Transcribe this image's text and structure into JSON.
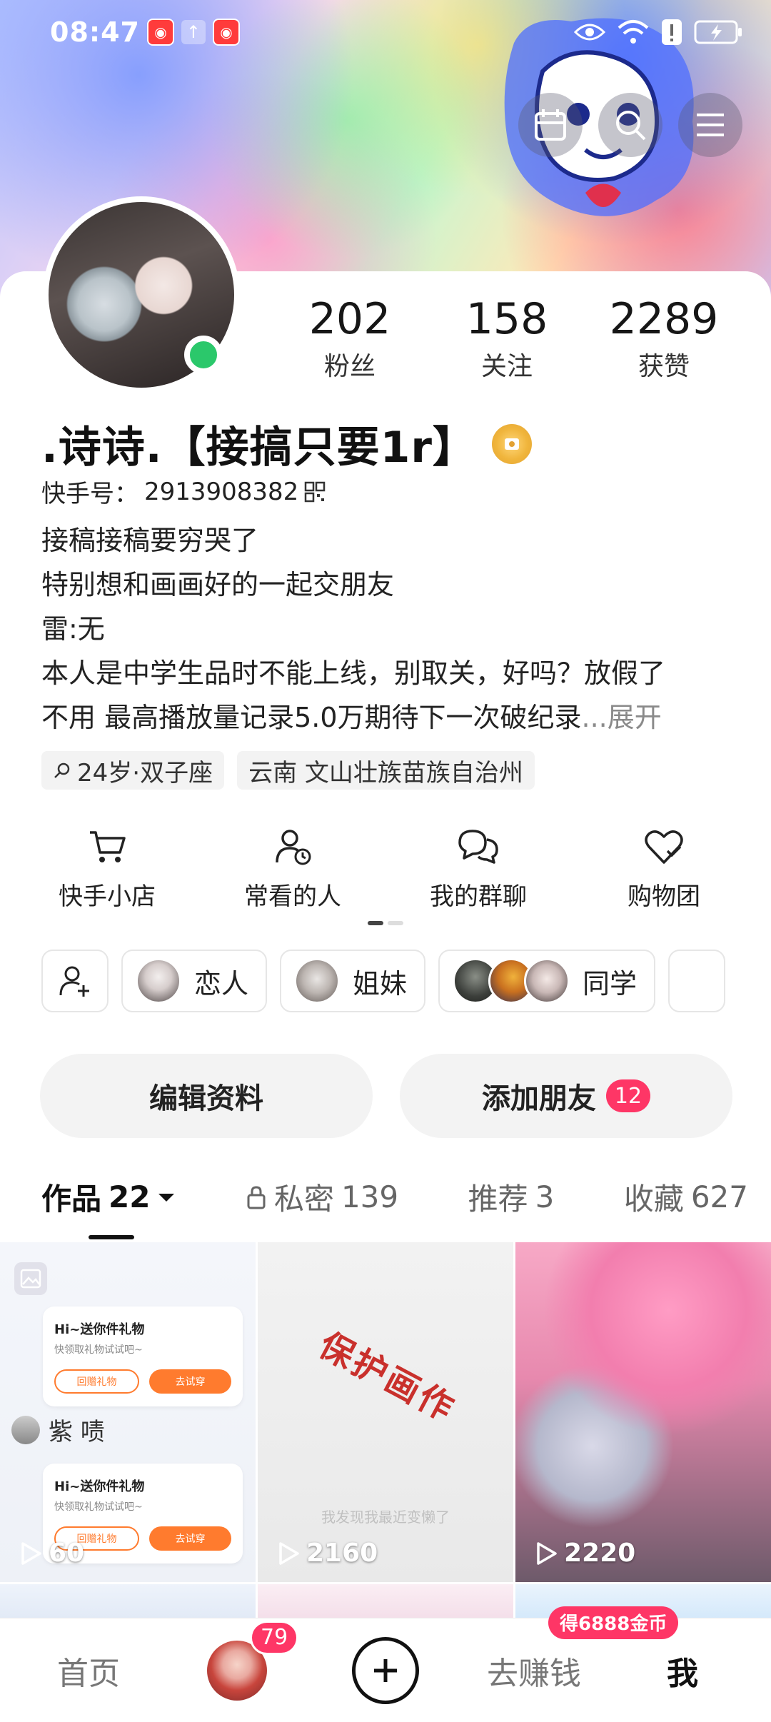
{
  "status_bar": {
    "time": "08:47",
    "icons": [
      "app-notification-icon",
      "upload-icon",
      "app-notification-icon",
      "eye-icon",
      "wifi-icon",
      "alert-icon",
      "battery-charging-icon"
    ]
  },
  "header_actions": [
    "calendar-icon",
    "search-icon",
    "menu-icon"
  ],
  "profile": {
    "name": ".诗诗.【接搞只要1r】",
    "kuaishou_id_label": "快手号：",
    "kuaishou_id": "2913908382",
    "online": true,
    "stats": [
      {
        "value": "202",
        "label": "粉丝"
      },
      {
        "value": "158",
        "label": "关注"
      },
      {
        "value": "2289",
        "label": "获赞"
      }
    ],
    "bio_lines": [
      "接稿接稿要穷哭了",
      "特别想和画画好的一起交朋友",
      "雷:无",
      "本人是中学生品时不能上线，别取关，好吗？放假了",
      "不用 最高播放量记录5.0万期待下一次破纪录"
    ],
    "bio_more": "...展开",
    "tags": [
      "24岁·双子座",
      "云南 文山壮族苗族自治州"
    ]
  },
  "quick_actions": [
    {
      "label": "快手小店",
      "icon": "cart-icon"
    },
    {
      "label": "常看的人",
      "icon": "person-clock-icon"
    },
    {
      "label": "我的群聊",
      "icon": "group-chat-icon"
    },
    {
      "label": "购物团",
      "icon": "heart-check-icon"
    }
  ],
  "relations": [
    {
      "label": "恋人",
      "avatars": 1
    },
    {
      "label": "姐妹",
      "avatars": 1
    },
    {
      "label": "同学",
      "avatars": 3
    }
  ],
  "buttons": {
    "edit_profile": "编辑资料",
    "add_friend": "添加朋友",
    "add_friend_count": "12"
  },
  "tabs": [
    {
      "label": "作品",
      "count": "22",
      "active": true
    },
    {
      "label": "私密",
      "count": "139",
      "active": false
    },
    {
      "label": "推荐",
      "count": "3",
      "active": false
    },
    {
      "label": "收藏",
      "count": "627",
      "active": false
    }
  ],
  "grid": [
    {
      "plays": "60",
      "mini_title": "Hi~送你件礼物",
      "mini_sub": "快领取礼物试试吧~",
      "mini_btn1": "回赠礼物",
      "mini_btn2": "去试穿",
      "name_tag": "紫 啧"
    },
    {
      "plays": "2160",
      "stamp": "保护画作",
      "caption": "我发现我最近变懒了"
    },
    {
      "plays": "2220"
    }
  ],
  "bottom_nav": {
    "home": "首页",
    "avatar_badge": "79",
    "earn": "去赚钱",
    "earn_badge": "得6888金币",
    "me": "我"
  },
  "colors": {
    "accent_red": "#fe3666",
    "online_green": "#2bc86b",
    "orange": "#ff7b2e"
  }
}
